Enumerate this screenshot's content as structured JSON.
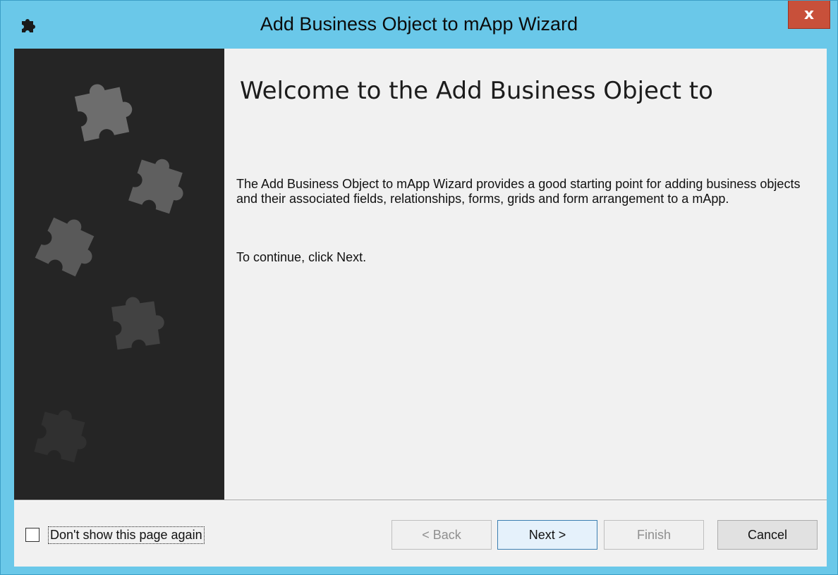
{
  "window": {
    "title": "Add Business Object to mApp Wizard",
    "close_label": "x"
  },
  "page": {
    "heading": "Welcome to the Add Business Object to",
    "description": "The Add Business Object to mApp Wizard provides a good starting point for adding business objects and their associated fields, relationships, forms, grids and form arrangement to a mApp.",
    "continue_text": "To continue, click Next."
  },
  "footer": {
    "dont_show_label": "Don't show this page again",
    "dont_show_checked": false,
    "back_label": "< Back",
    "next_label": "Next >",
    "finish_label": "Finish",
    "cancel_label": "Cancel"
  },
  "icons": {
    "app": "puzzle-piece-icon",
    "close": "close-icon",
    "side_decoration": "puzzle-pieces-graphic"
  },
  "colors": {
    "titlebar": "#6ac8e9",
    "close_button": "#c8503a",
    "side_panel": "#252525",
    "client_background": "#f1f1f1"
  }
}
